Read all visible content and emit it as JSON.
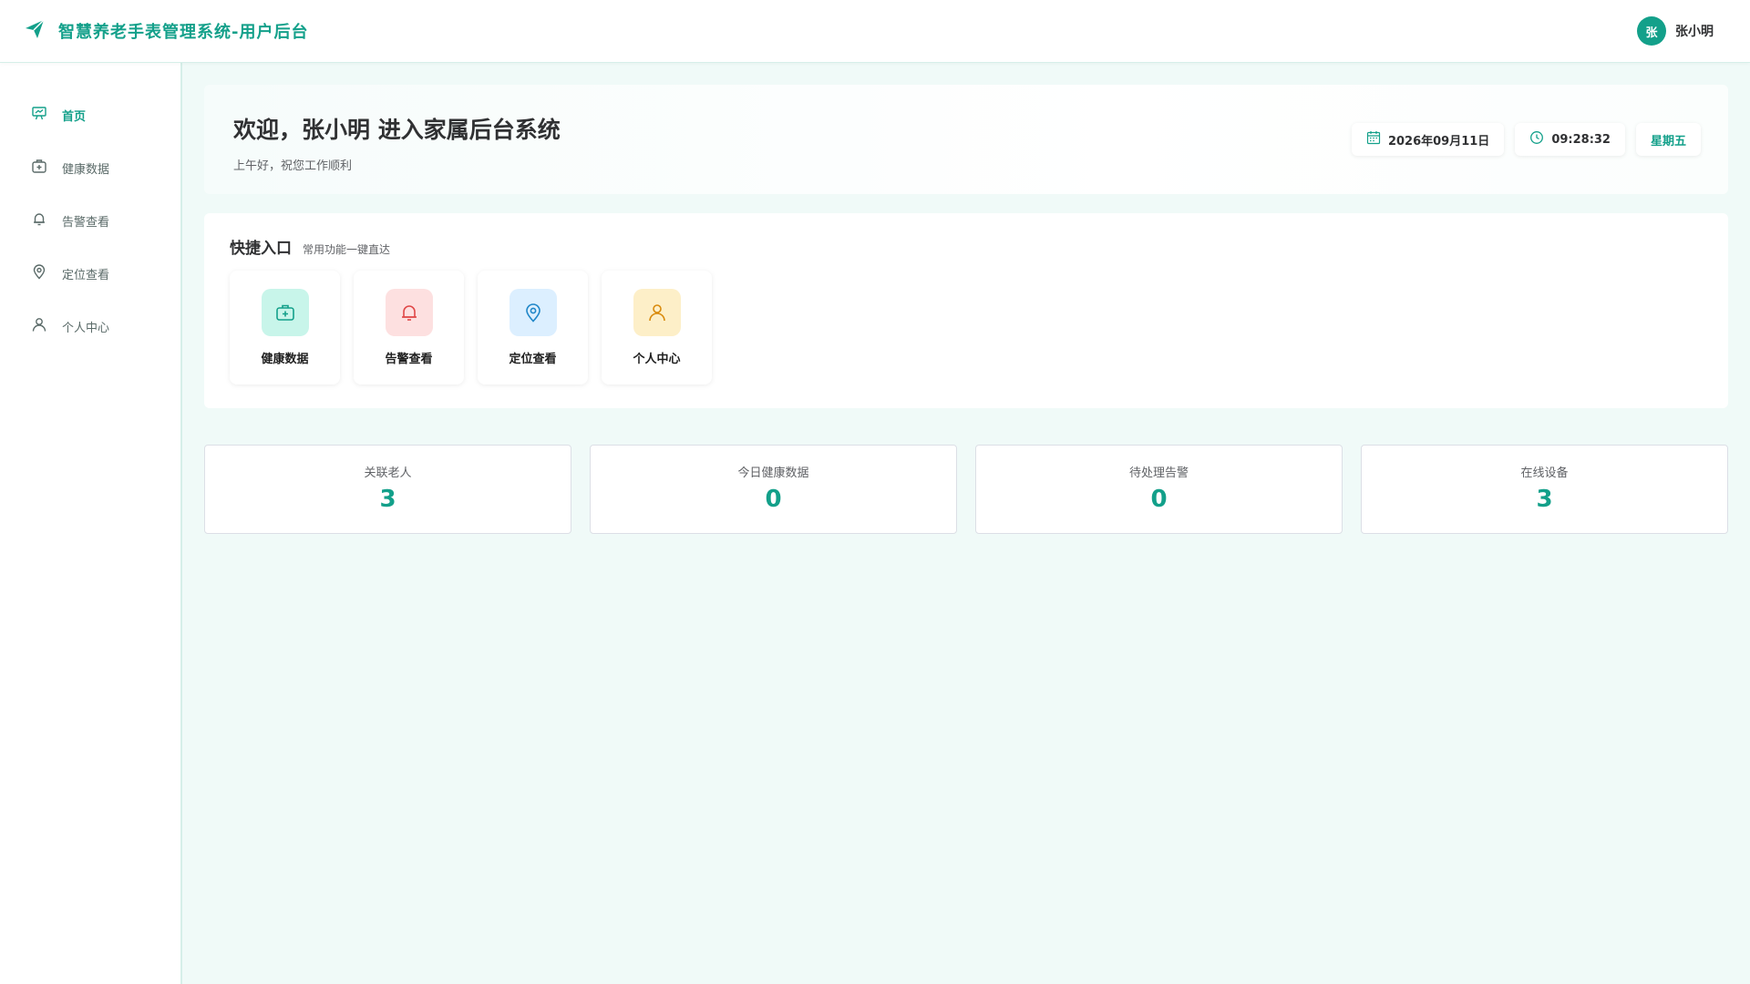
{
  "header": {
    "title": "智慧养老手表管理系统-用户后台",
    "avatar_text": "张",
    "user_name": "张小明"
  },
  "sidebar": {
    "items": [
      {
        "label": "首页",
        "icon": "home-icon",
        "active": true
      },
      {
        "label": "健康数据",
        "icon": "medical-kit-icon"
      },
      {
        "label": "告警查看",
        "icon": "bell-icon"
      },
      {
        "label": "定位查看",
        "icon": "location-pin-icon"
      },
      {
        "label": "个人中心",
        "icon": "user-icon"
      }
    ]
  },
  "welcome": {
    "title": "欢迎，张小明 进入家属后台系统",
    "subtitle": "上午好，祝您工作顺利",
    "date": "2026年09月11日",
    "time": "09:28:32",
    "weekday": "星期五"
  },
  "quick": {
    "title": "快捷入口",
    "subtitle": "常用功能一键直达",
    "items": [
      {
        "label": "健康数据",
        "icon": "medical-kit-icon",
        "bg": "#c8f5ea",
        "color": "#13a08a"
      },
      {
        "label": "告警查看",
        "icon": "bell-icon",
        "bg": "#fde0e0",
        "color": "#e04848"
      },
      {
        "label": "定位查看",
        "icon": "location-pin-icon",
        "bg": "#dcefff",
        "color": "#1f86c8"
      },
      {
        "label": "个人中心",
        "icon": "user-icon",
        "bg": "#fdefc8",
        "color": "#d98a0b"
      }
    ]
  },
  "stats": [
    {
      "label": "关联老人",
      "value": "3"
    },
    {
      "label": "今日健康数据",
      "value": "0"
    },
    {
      "label": "待处理告警",
      "value": "0"
    },
    {
      "label": "在线设备",
      "value": "3"
    }
  ],
  "colors": {
    "accent": "#13a08a",
    "page_bg": "#f0faf8"
  }
}
